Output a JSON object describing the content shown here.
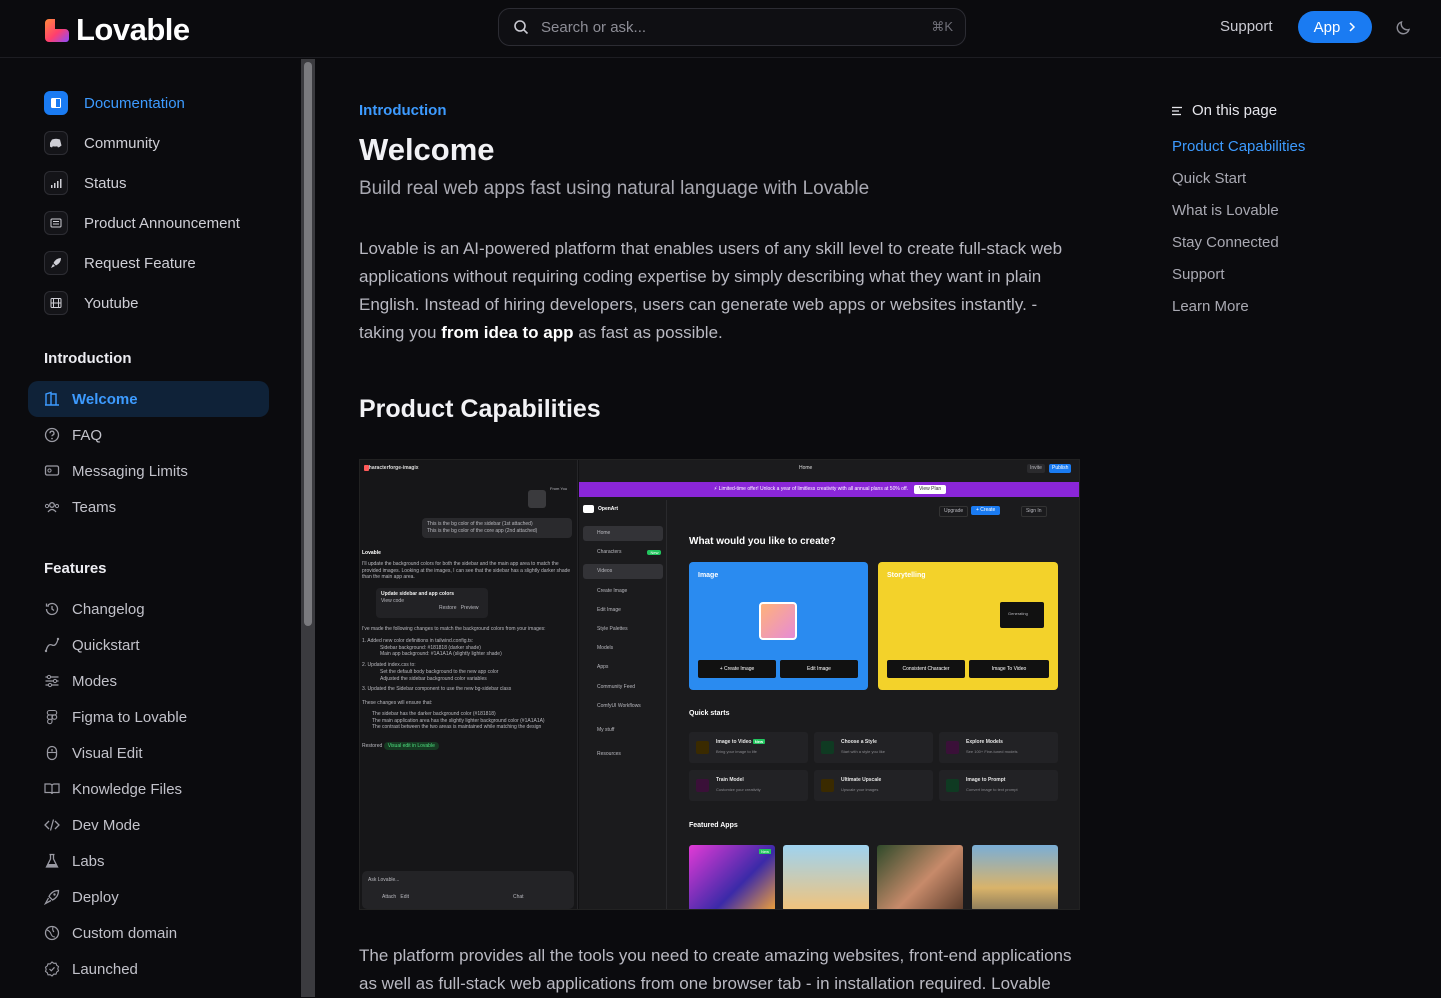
{
  "header": {
    "logo_text": "Lovable",
    "search_placeholder": "Search or ask...",
    "search_shortcut": "⌘K",
    "support_label": "Support",
    "app_label": "App"
  },
  "sidebar": {
    "top_links": [
      {
        "label": "Documentation",
        "icon": "book-icon"
      },
      {
        "label": "Community",
        "icon": "discord-icon"
      },
      {
        "label": "Status",
        "icon": "signal-icon"
      },
      {
        "label": "Product Announcement",
        "icon": "newspaper-icon"
      },
      {
        "label": "Request Feature",
        "icon": "rocket-icon"
      },
      {
        "label": "Youtube",
        "icon": "film-icon"
      }
    ],
    "groups": [
      {
        "title": "Introduction",
        "items": [
          {
            "label": "Welcome",
            "icon": "door-icon"
          },
          {
            "label": "FAQ",
            "icon": "question-icon"
          },
          {
            "label": "Messaging Limits",
            "icon": "message-icon"
          },
          {
            "label": "Teams",
            "icon": "users-icon"
          }
        ]
      },
      {
        "title": "Features",
        "items": [
          {
            "label": "Changelog",
            "icon": "history-icon"
          },
          {
            "label": "Quickstart",
            "icon": "spline-icon"
          },
          {
            "label": "Modes",
            "icon": "sliders-icon"
          },
          {
            "label": "Figma to Lovable",
            "icon": "figma-icon"
          },
          {
            "label": "Visual Edit",
            "icon": "mouse-icon"
          },
          {
            "label": "Knowledge Files",
            "icon": "book-open-icon"
          },
          {
            "label": "Dev Mode",
            "icon": "code-icon"
          },
          {
            "label": "Labs",
            "icon": "flask-icon"
          },
          {
            "label": "Deploy",
            "icon": "rocket-icon"
          },
          {
            "label": "Custom domain",
            "icon": "globe-icon"
          },
          {
            "label": "Launched",
            "icon": "badge-icon"
          }
        ]
      }
    ]
  },
  "main": {
    "breadcrumb": "Introduction",
    "title": "Welcome",
    "subtitle": "Build real web apps fast using natural language with Lovable",
    "intro_text_1": "Lovable is an AI-powered platform that enables users of any skill level to create full-stack web applications without requiring coding expertise by simply describing what they want in plain English. Instead of hiring developers, users can generate web apps or websites instantly. - taking you ",
    "intro_bold": "from idea to app",
    "intro_text_2": " as fast as possible.",
    "section_title": "Product Capabilities",
    "bottom_text": "The platform provides all the tools you need to create amazing websites, front-end applications as well as full-stack web applications from one browser tab - in installation required. Lovable"
  },
  "embedded": {
    "project_name": "characterforge-imagix",
    "from_you": "From You",
    "user_msg_1": "This is the bg color of the sidebar (1st attached)",
    "user_msg_2": "This is the bg color of the core app (2nd attached)",
    "assistant_name": "Lovable",
    "assistant_msg": "I'll update the background colors for both the sidebar and the main app area to match the provided images. Looking at the images, I can see that the sidebar has a slightly darker shade than the main app area.",
    "edit_title": "Update sidebar and app colors",
    "view_code": "View code",
    "restore": "Restore",
    "preview": "Preview",
    "changes_intro": "I've made the following changes to match the background colors from your images:",
    "change_1": "1.  Added new color definitions in tailwind.config.ts:",
    "change_1a": "Sidebar background: #181818 (darker shade)",
    "change_1b": "Main app background: #1A1A1A (slightly lighter shade)",
    "change_2": "2.  Updated index.css to:",
    "change_2a": "Set the default body background to the new app color",
    "change_2b": "Adjusted the sidebar background color variables",
    "change_3": "3.  Updated the Sidebar component to use the new bg-sidebar class",
    "ensure": "These changes will ensure that:",
    "ensure_1": "The sidebar has the darker background color (#181818)",
    "ensure_2": "The main application area has the slightly lighter background color (#1A1A1A)",
    "ensure_3": "The contrast between the two areas is maintained while matching the design",
    "restored": "Restored",
    "visual_edit_tag": "Visual edit in Lovable",
    "ask_placeholder": "Ask Lovable...",
    "attach": "Attach",
    "edit": "Edit",
    "chat": "Chat",
    "tab_home": "Home",
    "invite": "Invite",
    "publish": "Publish",
    "promo_text": "⚡ Limited-time offer! Unlock a year of limitless creativity with all annual plans at 50% off.",
    "promo_button": "View Plan",
    "brand": "OpenArt",
    "nav": [
      "Home",
      "Characters",
      "Videos",
      "Create Image",
      "Edit Image",
      "Style Palettes",
      "Models",
      "Apps",
      "Community Feed",
      "ComfyUI Workflows",
      "My stuff",
      "Resources"
    ],
    "characters_badge": "New",
    "upgrade": "Upgrade",
    "create": "+ Create",
    "sign_in": "Sign In",
    "question": "What would you like to create?",
    "card_image": "Image",
    "card_story": "Storytelling",
    "btn_create_image": "+ Create Image",
    "btn_edit_image": "Edit Image",
    "btn_consistent": "Consistent Character",
    "btn_img_to_video": "Image To Video",
    "generating": "Generating",
    "quick_starts": "Quick starts",
    "qs": [
      {
        "t": "Image to Video",
        "s": "Bring your image to life",
        "badge": "New"
      },
      {
        "t": "Choose a Style",
        "s": "Start with a style you like"
      },
      {
        "t": "Explore Models",
        "s": "See 100+ Fine-tuned models"
      },
      {
        "t": "Train Model",
        "s": "Customize your creativity"
      },
      {
        "t": "Ultimate Upscale",
        "s": "Upscale your images"
      },
      {
        "t": "Image to Prompt",
        "s": "Convert image to text prompt"
      }
    ],
    "featured_apps": "Featured Apps",
    "featured_badge": "New"
  },
  "toc": {
    "title": "On this page",
    "items": [
      "Product Capabilities",
      "Quick Start",
      "What is Lovable",
      "Stay Connected",
      "Support",
      "Learn More"
    ]
  },
  "colors": {
    "accent": "#1a7bf2",
    "link": "#3d9bff",
    "background": "#0b0b0e",
    "promo": "#8a26d8",
    "card_blue": "#2a8bf0",
    "card_yellow": "#f3d22a"
  }
}
